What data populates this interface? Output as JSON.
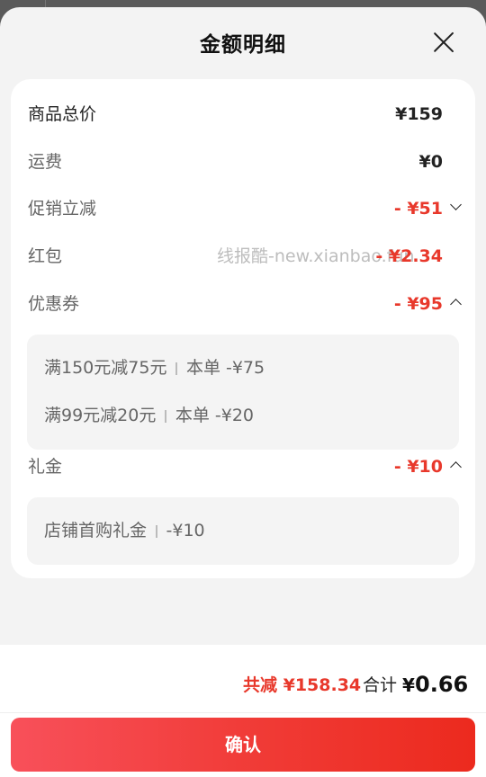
{
  "header": {
    "title": "金额明细"
  },
  "rows": {
    "goods_total": {
      "label": "商品总价",
      "value": "¥159"
    },
    "shipping": {
      "label": "运费",
      "value": "¥0"
    },
    "promo": {
      "label": "促销立减",
      "value": "- ¥51"
    },
    "red_packet": {
      "label": "红包",
      "value": "- ¥2.34"
    },
    "coupon": {
      "label": "优惠券",
      "value": "- ¥95"
    },
    "gift_money": {
      "label": "礼金",
      "value": "- ¥10"
    }
  },
  "watermark": "线报酷-new.xianbao.fun",
  "coupon_items": [
    {
      "rule": "满150元减75元",
      "detail": "本单 -¥75"
    },
    {
      "rule": "满99元减20元",
      "detail": "本单 -¥20"
    }
  ],
  "gift_items": [
    {
      "rule": "店铺首购礼金",
      "detail": "-¥10"
    }
  ],
  "footer": {
    "total_reduce": "共减 ¥158.34",
    "total_label": "合计",
    "total_symbol": "¥",
    "total_amount": "0.66",
    "confirm_label": "确认"
  },
  "colors": {
    "accent_red": "#e8382b",
    "button_start": "#f8505a",
    "button_end": "#ec2a1e"
  }
}
